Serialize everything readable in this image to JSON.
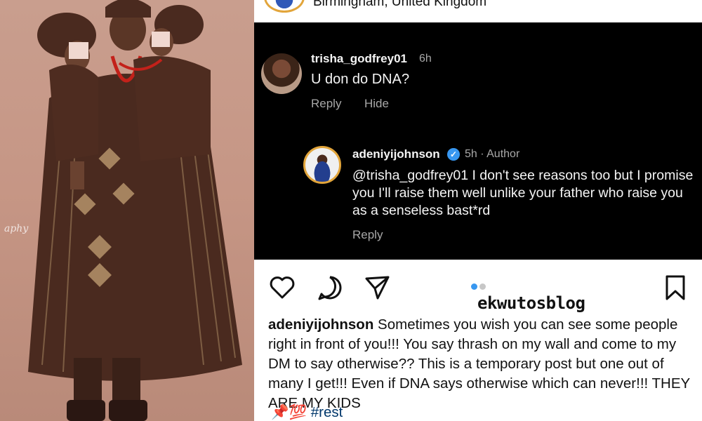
{
  "location_header": {
    "text": "Birmingham, United Kingdom"
  },
  "photo": {
    "watermark": "aphy"
  },
  "comment1": {
    "username": "trisha_godfrey01",
    "time": "6h",
    "text": "U don do DNA?",
    "reply_label": "Reply",
    "hide_label": "Hide"
  },
  "comment2": {
    "username": "adeniyijohnson",
    "meta": "5h · Author",
    "text": "@trisha_godfrey01 I don't see reasons too but I promise you I'll raise them well unlike your father who raise you as a senseless bast*rd",
    "reply_label": "Reply"
  },
  "actions": {
    "icons": [
      "heart-icon",
      "comment-icon",
      "share-icon",
      "bookmark-icon"
    ],
    "carousel_dots": 2,
    "active_dot": 0
  },
  "watermark_text": "ekwutosblog",
  "caption": {
    "username": "adeniyijohnson",
    "text": " Sometimes you wish you can see some people right in front of you!!! You say thrash on my wall and come to my DM to say otherwise?? This is a temporary post but one out of many I get!!! Even if DNA says otherwise which can never!!! THEY ARE MY KIDS",
    "emoji": "📌💯",
    "hashtag": "#rest"
  },
  "colors": {
    "accent_blue": "#3897f0",
    "hashtag": "#00376b",
    "comments_bg": "#000000",
    "muted": "#a8a8a8"
  }
}
